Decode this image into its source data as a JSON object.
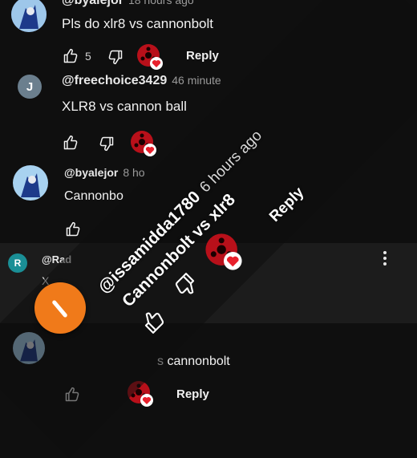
{
  "comments": [
    {
      "handle": "@byalejor",
      "time": "18 hours ago",
      "text": "Pls do xlr8 vs cannonbolt",
      "likes": "5",
      "reply": "Reply"
    },
    {
      "handle": "@freechoice3429",
      "time": "46 minute",
      "text": "XLR8 vs cannon ball",
      "avatar_letter": "J"
    },
    {
      "handle": "@byalejor",
      "time": "8 ho",
      "text": "Cannonbo"
    },
    {
      "handle": "@Rad",
      "text": "X",
      "avatar_letter": "R"
    },
    {
      "text": "s cannonbolt",
      "reply": "Reply"
    }
  ],
  "overlay": {
    "handle": "@issamidda1780",
    "time": "6 hours ago",
    "text": "Cannonbolt vs xlr8",
    "reply": "Reply"
  },
  "colors": {
    "background": "#0f0f0f",
    "fab": "#f07a1a",
    "heart": "#e8202c",
    "avatar_j": "#6b7f8e",
    "avatar_r": "#1a8f96"
  },
  "icons": [
    "thumbs-up-icon",
    "thumbs-down-icon",
    "heart-avatar-icon",
    "more-vert-icon",
    "edit-icon"
  ]
}
